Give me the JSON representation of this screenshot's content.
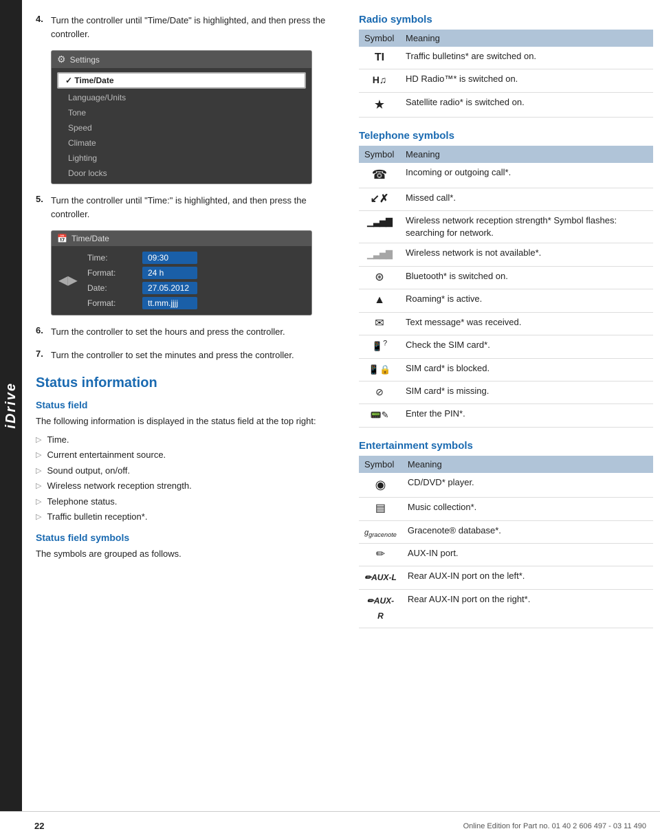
{
  "idrive": {
    "label": "iDrive"
  },
  "steps": [
    {
      "num": "4.",
      "text": "Turn the controller until \"Time/Date\" is highlighted, and then press the controller."
    },
    {
      "num": "5.",
      "text": "Turn the controller until \"Time:\" is highlighted, and then press the controller."
    },
    {
      "num": "6.",
      "text": "Turn the controller to set the hours and press the controller."
    },
    {
      "num": "7.",
      "text": "Turn the controller to set the minutes and press the controller."
    }
  ],
  "screen1": {
    "header": "Settings",
    "items": [
      "Time/Date",
      "Language/Units",
      "Tone",
      "Speed",
      "Climate",
      "Lighting",
      "Door locks"
    ]
  },
  "screen2": {
    "header": "Time/Date",
    "rows": [
      {
        "label": "Time:",
        "value": "09:30"
      },
      {
        "label": "Format:",
        "value": "24 h"
      },
      {
        "label": "Date:",
        "value": "27.05.2012"
      },
      {
        "label": "Format:",
        "value": "tt.mm.jjjj"
      }
    ]
  },
  "status_info": {
    "section_title": "Status information",
    "status_field_heading": "Status field",
    "status_field_text": "The following information is displayed in the status field at the top right:",
    "bullet_items": [
      "Time.",
      "Current entertainment source.",
      "Sound output, on/off.",
      "Wireless network reception strength.",
      "Telephone status.",
      "Traffic bulletin reception*."
    ],
    "symbols_heading": "Status field symbols",
    "symbols_text": "The symbols are grouped as follows."
  },
  "radio_symbols": {
    "heading": "Radio symbols",
    "col_symbol": "Symbol",
    "col_meaning": "Meaning",
    "rows": [
      {
        "symbol": "TI",
        "meaning": "Traffic bulletins* are switched on."
      },
      {
        "symbol": "H♪",
        "meaning": "HD Radio™* is switched on."
      },
      {
        "symbol": "★",
        "meaning": "Satellite radio* is switched on."
      }
    ]
  },
  "telephone_symbols": {
    "heading": "Telephone symbols",
    "col_symbol": "Symbol",
    "col_meaning": "Meaning",
    "rows": [
      {
        "symbol": "☎",
        "meaning": "Incoming or outgoing call*."
      },
      {
        "symbol": "↗",
        "meaning": "Missed call*."
      },
      {
        "symbol": "▮▮▮",
        "meaning": "Wireless network reception strength* Symbol flashes: searching for network."
      },
      {
        "symbol": "▯▯▯",
        "meaning": "Wireless network is not available*."
      },
      {
        "symbol": "⊛",
        "meaning": "Bluetooth* is switched on."
      },
      {
        "symbol": "▲",
        "meaning": "Roaming* is active."
      },
      {
        "symbol": "✉",
        "meaning": "Text message* was received."
      },
      {
        "symbol": "📱",
        "meaning": "Check the SIM card*."
      },
      {
        "symbol": "🔒",
        "meaning": "SIM card* is blocked."
      },
      {
        "symbol": "⊘",
        "meaning": "SIM card* is missing."
      },
      {
        "symbol": "📟",
        "meaning": "Enter the PIN*."
      }
    ]
  },
  "entertainment_symbols": {
    "heading": "Entertainment symbols",
    "col_symbol": "Symbol",
    "col_meaning": "Meaning",
    "rows": [
      {
        "symbol": "◉",
        "meaning": "CD/DVD* player."
      },
      {
        "symbol": "▤",
        "meaning": "Music collection*."
      },
      {
        "symbol": "g",
        "meaning": "Gracenote® database*."
      },
      {
        "symbol": "✏",
        "meaning": "AUX-IN port."
      },
      {
        "symbol": "✏AUX-L",
        "meaning": "Rear AUX-IN port on the left*."
      },
      {
        "symbol": "✏AUX-R",
        "meaning": "Rear AUX-IN port on the right*."
      }
    ]
  },
  "footer": {
    "page_num": "22",
    "text": "Online Edition for Part no. 01 40 2 606 497 - 03 11 490"
  }
}
